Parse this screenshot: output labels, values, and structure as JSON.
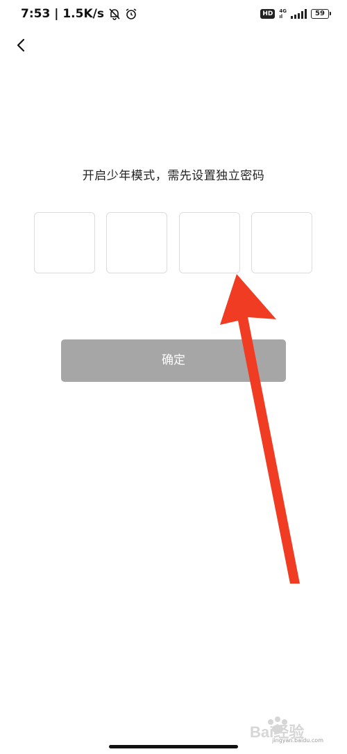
{
  "status_bar": {
    "time_speed": "7:53 | 1.5K/s",
    "hd": "HD",
    "network_top": "4G",
    "network_bottom": "ıl",
    "battery": "59",
    "icons": [
      "mute-bell-icon",
      "alarm-icon",
      "signal-icon",
      "battery-icon"
    ]
  },
  "header": {
    "back_icon": "chevron-left-icon"
  },
  "main": {
    "title": "开启少年模式，需先设置独立密码",
    "code_boxes": [
      "",
      "",
      "",
      ""
    ],
    "confirm_label": "确定",
    "confirm_enabled": false
  },
  "annotation": {
    "arrow_color": "#f03c23",
    "arrow_icon": "arrow-pointer-icon"
  },
  "watermark": {
    "text": "Bai经验",
    "subtext": "jingyan.baidu.com",
    "icon": "paw-icon"
  },
  "colors": {
    "button_disabled": "#a6a6a6",
    "box_border": "#dcdcdc",
    "text": "#222222"
  }
}
